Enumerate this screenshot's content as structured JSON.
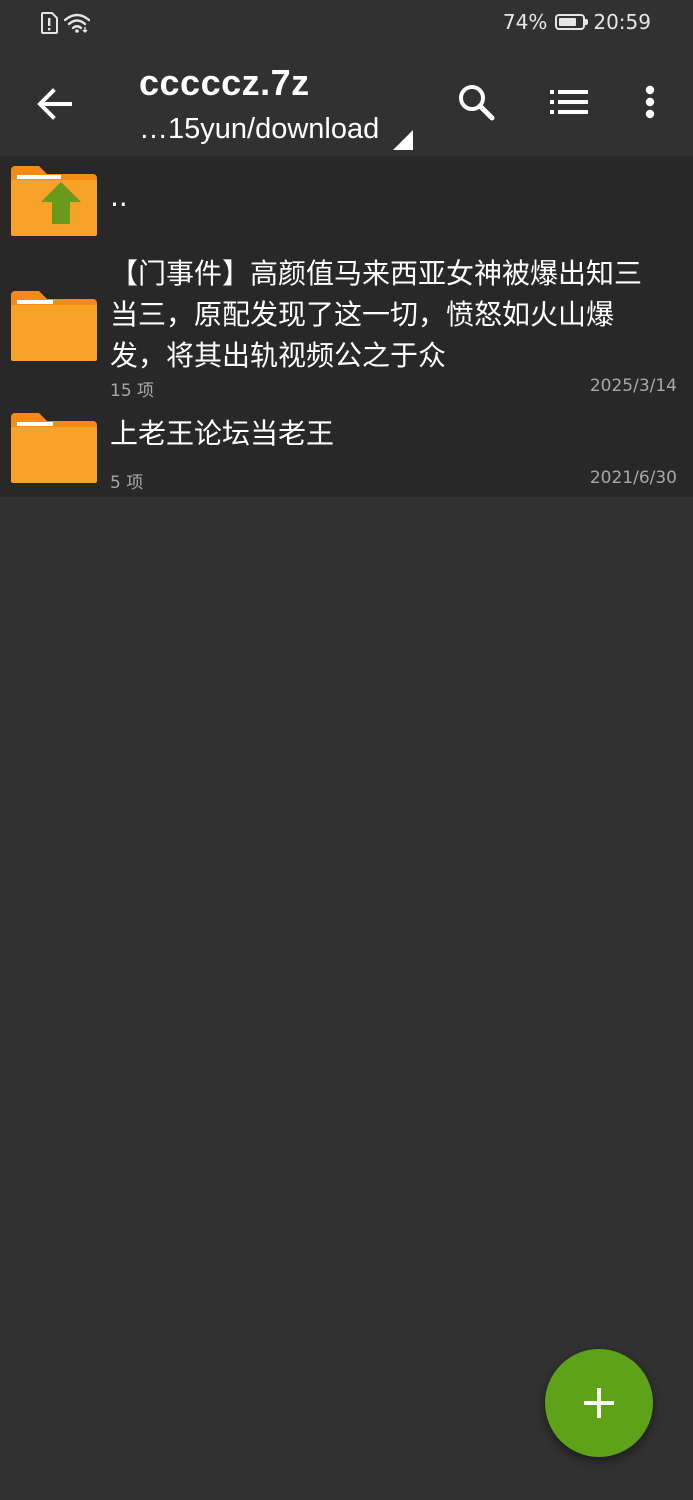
{
  "status_bar": {
    "battery_percent": "74%",
    "battery_level": 0.74,
    "time": "20:59",
    "icons": [
      "alert-sim-icon",
      "wifi-icon",
      "battery-icon"
    ]
  },
  "toolbar": {
    "title": "cccccz.7z",
    "subtitle": "…15yun/download",
    "icons": [
      "back-arrow-icon",
      "search-icon",
      "list-view-icon",
      "more-vert-icon"
    ]
  },
  "files": {
    "items": [
      {
        "name": "..",
        "meta": "",
        "date": "",
        "icon": "folder-up-icon"
      },
      {
        "name": "【门事件】高颜值马来西亚女神被爆出知三当三，原配发现了这一切，愤怒如火山爆发，将其出轨视频公之于众",
        "meta": "15 项",
        "date": "2025/3/14",
        "icon": "folder-icon"
      },
      {
        "name": "上老王论坛当老王",
        "meta": "5 项",
        "date": "2021/6/30",
        "icon": "folder-icon"
      }
    ]
  },
  "fab": {
    "icon": "plus-icon"
  },
  "colors": {
    "background": "#313131",
    "list_background": "#282828",
    "folder": "#f8a328",
    "folder_tab": "#f28c14",
    "up_arrow": "#6a9a1b",
    "fab": "#5da218",
    "secondary_text": "#a8a8a8"
  }
}
